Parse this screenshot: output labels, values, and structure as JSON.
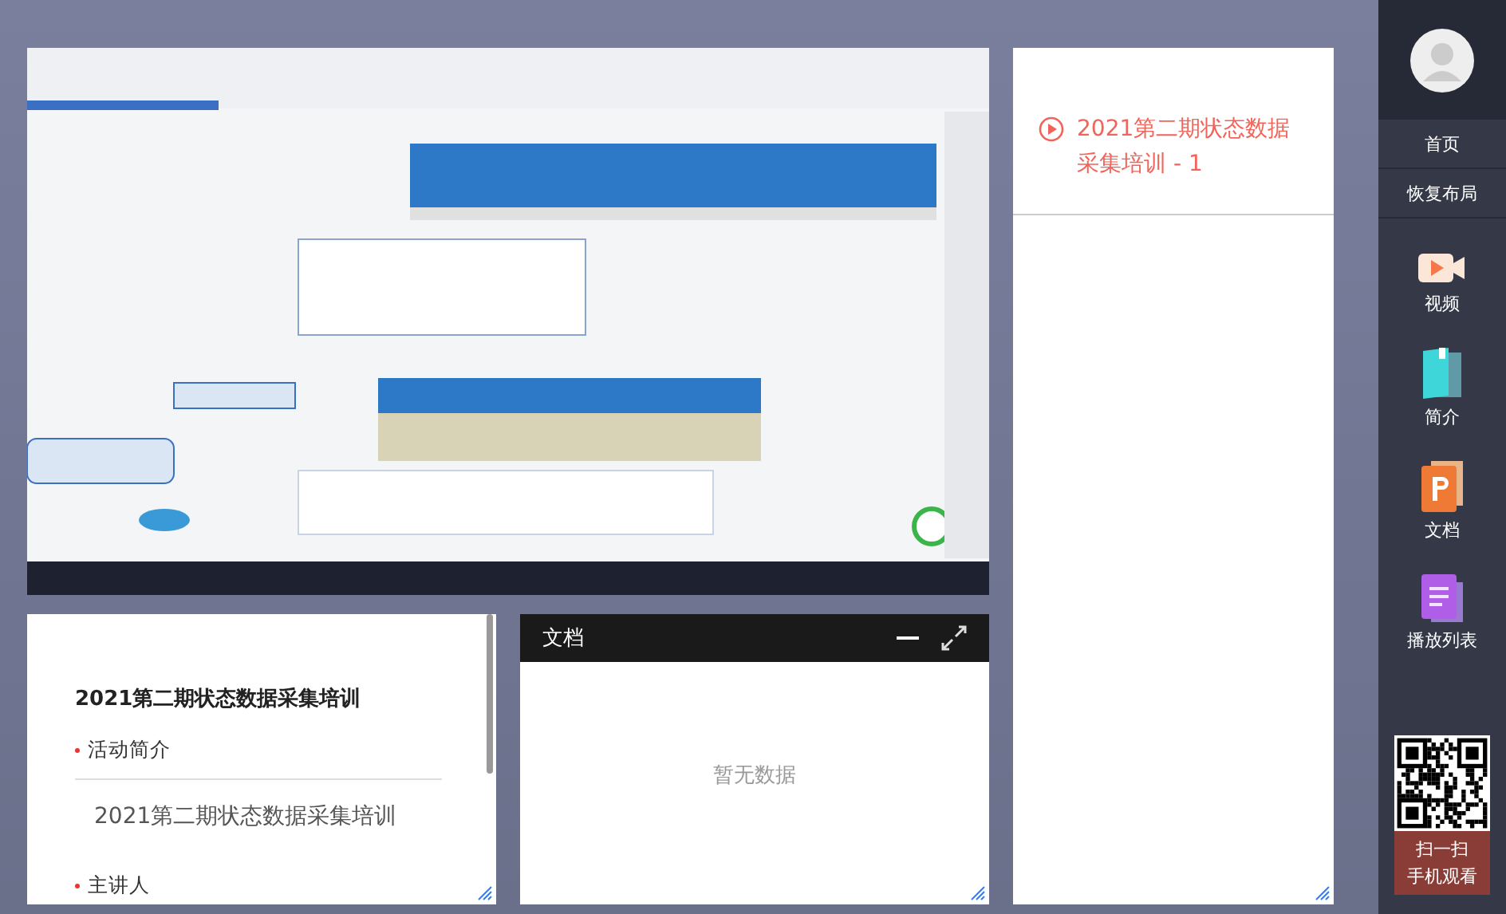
{
  "intro": {
    "title": "2021第二期状态数据采集培训",
    "sections": [
      {
        "heading": "活动简介",
        "body": "2021第二期状态数据采集培训"
      },
      {
        "heading": "主讲人"
      }
    ]
  },
  "document": {
    "title": "文档",
    "empty_text": "暂无数据"
  },
  "playlist": [
    {
      "title": "2021第二期状态数据采集培训 - 1",
      "selected": true
    }
  ],
  "sidebar": {
    "nav": [
      {
        "label": "首页"
      },
      {
        "label": "恢复布局"
      }
    ],
    "apps": [
      {
        "kind": "video",
        "label": "视频"
      },
      {
        "kind": "intro",
        "label": "简介"
      },
      {
        "kind": "document",
        "label": "文档"
      },
      {
        "kind": "playlist",
        "label": "播放列表"
      }
    ],
    "qr": {
      "lines": [
        "扫一扫",
        "手机观看"
      ]
    }
  }
}
